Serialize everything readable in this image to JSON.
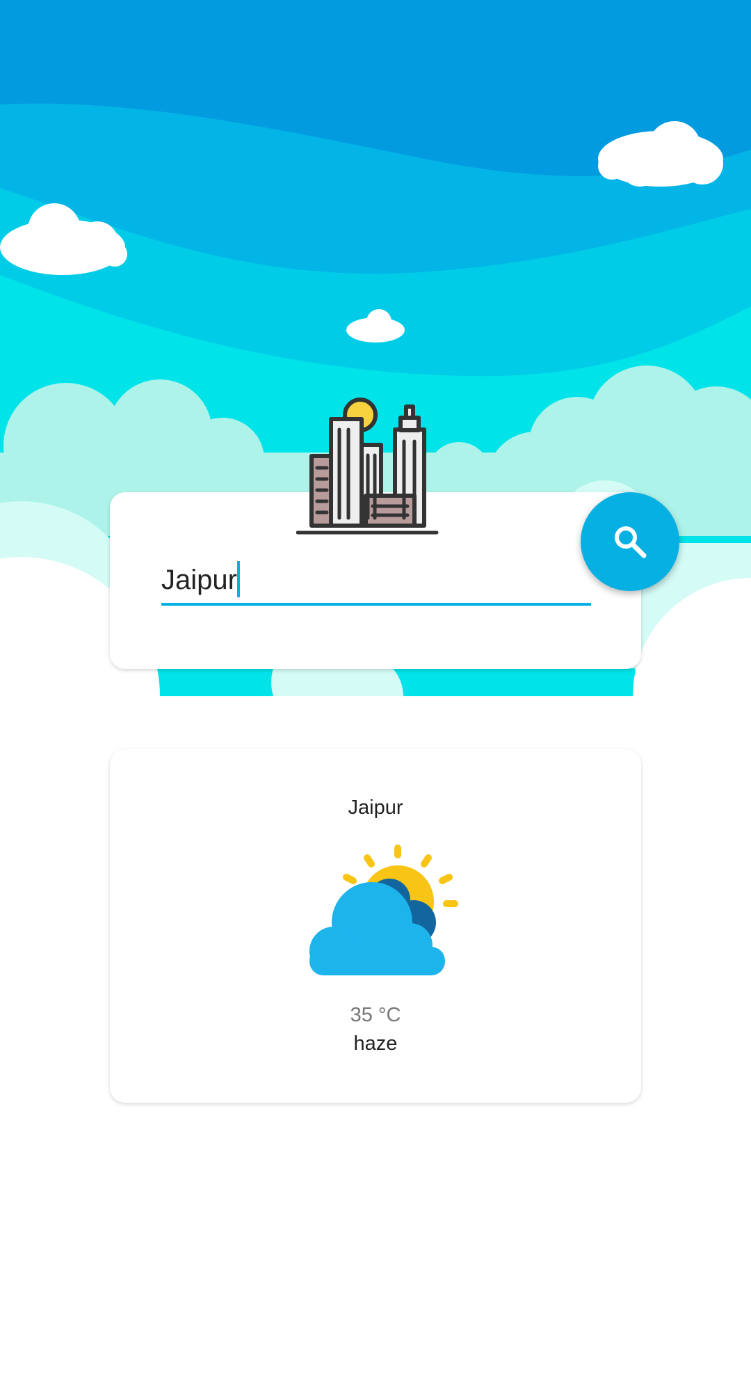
{
  "header": {
    "illustration": "sky-clouds-background",
    "city_icon": "city-buildings-icon"
  },
  "search": {
    "value": "Jaipur",
    "placeholder": "",
    "button_icon": "search-icon"
  },
  "result": {
    "city": "Jaipur",
    "weather_icon": "partly-cloudy-icon",
    "temperature": "35 °C",
    "description": "haze"
  },
  "colors": {
    "accent": "#06b0e3",
    "sky_top": "#039be0",
    "sky_mid": "#00c8e6",
    "sky_low": "#00e2e8",
    "cloud_mint": "#aef3e9"
  }
}
